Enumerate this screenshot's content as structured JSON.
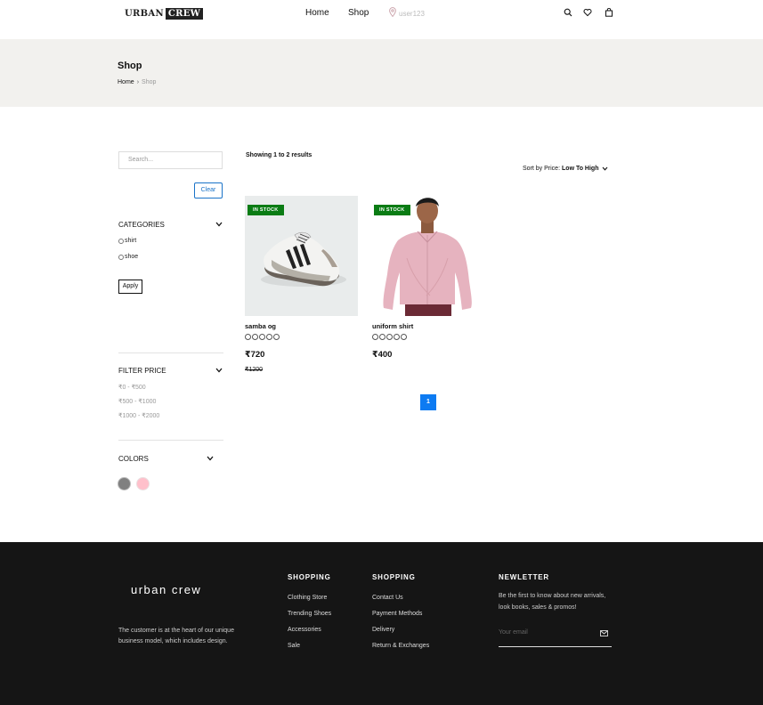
{
  "header": {
    "logo_word1": "URBAN",
    "logo_word2": "CREW",
    "nav": [
      {
        "label": "Home"
      },
      {
        "label": "Shop"
      }
    ],
    "username": "user123",
    "icons": [
      "search-icon",
      "heart-icon",
      "bag-icon"
    ]
  },
  "page": {
    "title": "Shop",
    "breadcrumb": {
      "home": "Home",
      "separator": "›",
      "current": "Shop"
    }
  },
  "sidebar": {
    "search_placeholder": "Search...",
    "clear_label": "Clear",
    "categories": {
      "title": "CATEGORIES",
      "options": [
        {
          "label": "shirt"
        },
        {
          "label": "shoe"
        }
      ],
      "apply_label": "Apply"
    },
    "filter_price": {
      "title": "FILTER PRICE",
      "ranges": [
        {
          "label": "₹0 - ₹500"
        },
        {
          "label": "₹500 - ₹1000"
        },
        {
          "label": "₹1000 - ₹2000"
        }
      ]
    },
    "colors": {
      "title": "COLORS",
      "swatches": [
        {
          "name": "gray",
          "color": "#808080"
        },
        {
          "name": "pink",
          "color": "#ffc0cb"
        }
      ]
    }
  },
  "results": {
    "showing_text": "Showing 1 to 2 results",
    "sort_label": "Sort by Price:",
    "sort_value": "Low To High",
    "products": [
      {
        "name": "samba og",
        "badge": "IN STOCK",
        "price": "₹720",
        "old_price": "₹1200",
        "rating": 0
      },
      {
        "name": "uniform shirt",
        "badge": "IN STOCK",
        "price": "₹400",
        "old_price": "",
        "rating": 0
      }
    ],
    "pagination": {
      "current": "1"
    }
  },
  "footer": {
    "logo": "urban crew",
    "description": "The customer is at the heart of our unique business model, which includes design.",
    "columns": [
      {
        "title": "SHOPPING",
        "links": [
          "Clothing Store",
          "Trending Shoes",
          "Accessories",
          "Sale"
        ]
      },
      {
        "title": "SHOPPING",
        "links": [
          "Contact Us",
          "Payment Methods",
          "Delivery",
          "Return & Exchanges"
        ]
      }
    ],
    "newsletter": {
      "title": "NEWLETTER",
      "text": "Be the first to know about new arrivals, look books, sales & promos!",
      "placeholder": "Your email"
    }
  },
  "colors": {
    "badge": "#0a7c14",
    "accent": "#0d7bf2",
    "footer_bg": "#151515",
    "page_head_bg": "#f2f1ee"
  }
}
